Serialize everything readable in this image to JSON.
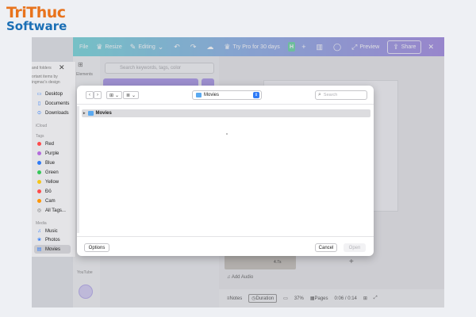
{
  "logo": {
    "line1": "TriThuc",
    "line2": "Software"
  },
  "canva": {
    "menu": {
      "file": "File",
      "resize": "Resize",
      "editing": "Editing",
      "try_pro": "Try Pro for 30 days",
      "avatar_letter": "H",
      "preview": "Preview",
      "share": "Share"
    },
    "rail": {
      "elements": "Elements",
      "youtube": "YouTube"
    },
    "search_placeholder": "Search keywords, tags, color",
    "timeline": {
      "add_audio": "Add Audio",
      "clip_label": "4.7s"
    },
    "bottom_bar": {
      "notes": "Notes",
      "duration": "Duration",
      "zoom": "37%",
      "pages": "Pages",
      "time": "0:06 / 0:14"
    }
  },
  "sidebar": {
    "faint_top": [
      "and folders",
      "ortant items by",
      "ingmac's design"
    ],
    "favorites": [
      {
        "label": "Desktop",
        "icon": "desktop-icon"
      },
      {
        "label": "Documents",
        "icon": "document-icon"
      },
      {
        "label": "Downloads",
        "icon": "download-icon"
      }
    ],
    "icloud_header": "iCloud",
    "tags_header": "Tags",
    "tags": [
      {
        "label": "Red",
        "color": "#ff4b4b"
      },
      {
        "label": "Purple",
        "color": "#b36bdc"
      },
      {
        "label": "Blue",
        "color": "#2f7bf6"
      },
      {
        "label": "Green",
        "color": "#35c759"
      },
      {
        "label": "Yellow",
        "color": "#f5c518"
      },
      {
        "label": "Đỏ",
        "color": "#ff4b4b"
      },
      {
        "label": "Cam",
        "color": "#ff9500"
      },
      {
        "label": "All Tags...",
        "color": ""
      }
    ],
    "media_header": "Media",
    "media": [
      {
        "label": "Music",
        "icon": "music-icon"
      },
      {
        "label": "Photos",
        "icon": "photos-icon"
      },
      {
        "label": "Movies",
        "icon": "movies-icon",
        "selected": true
      }
    ]
  },
  "dialog": {
    "location": "Movies",
    "search_placeholder": "Search",
    "rows": [
      {
        "name": "Movies"
      }
    ],
    "buttons": {
      "options": "Options",
      "cancel": "Cancel",
      "open": "Open"
    }
  }
}
